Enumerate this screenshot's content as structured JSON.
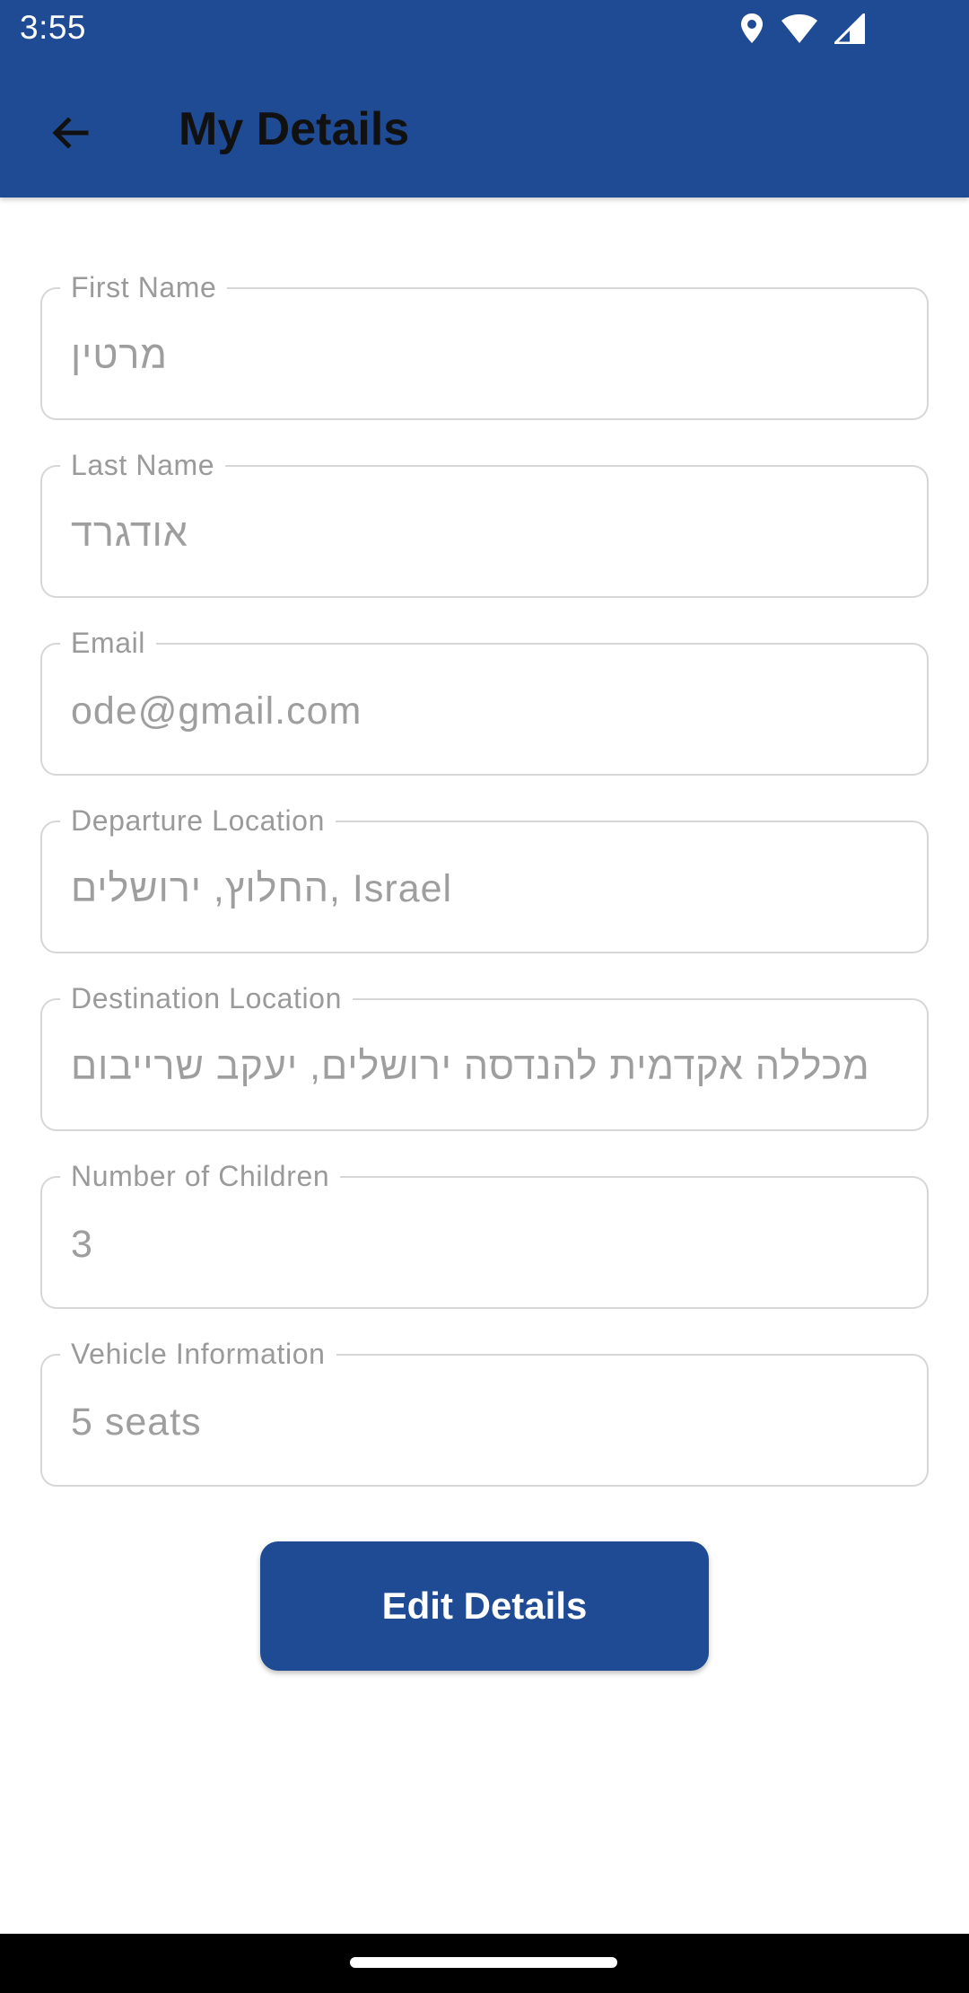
{
  "status_bar": {
    "time": "3:55",
    "icons": [
      "location-icon",
      "wifi-icon",
      "signal-icon"
    ],
    "color": "#1e4b93"
  },
  "app_bar": {
    "title": "My Details",
    "back_icon": "arrow-left-icon",
    "color": "#1e4b93"
  },
  "fields": {
    "first_name": {
      "label": "First Name",
      "value": "מרטין"
    },
    "last_name": {
      "label": "Last Name",
      "value": "אודגרד"
    },
    "email": {
      "label": "Email",
      "value": "ode@gmail.com"
    },
    "departure_location": {
      "label": "Departure Location",
      "value": "החלוץ, ירושלים, Israel"
    },
    "destination_location": {
      "label": "Destination Location",
      "value": "מכללה אקדמית להנדסה ירושלים, יעקב שרייבום"
    },
    "number_of_children": {
      "label": "Number of Children",
      "value": "3"
    },
    "vehicle_information": {
      "label": "Vehicle Information",
      "value": "5 seats"
    }
  },
  "edit_button": {
    "label": "Edit Details",
    "color": "#1e4b93"
  }
}
